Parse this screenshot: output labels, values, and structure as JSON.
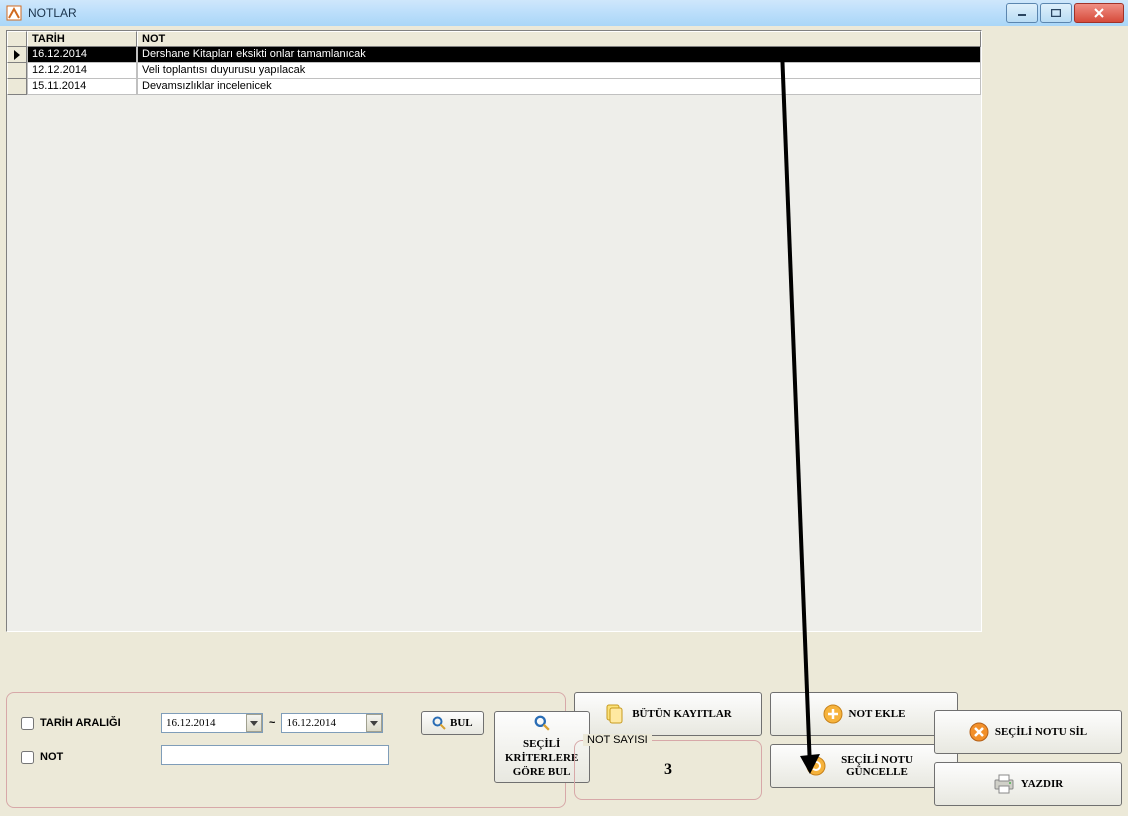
{
  "window": {
    "title": "NOTLAR"
  },
  "grid": {
    "columns": {
      "tarih": "TARİH",
      "not": "NOT"
    },
    "rows": [
      {
        "tarih": "16.12.2014",
        "not": "Dershane Kitapları eksikti onlar tamamlanıcak",
        "selected": true
      },
      {
        "tarih": "12.12.2014",
        "not": "Veli toplantısı duyurusu yapılacak",
        "selected": false
      },
      {
        "tarih": "15.11.2014",
        "not": "Devamsızlıklar incelenicek",
        "selected": false
      }
    ]
  },
  "filter": {
    "tarih_label": "TARİH ARALIĞI",
    "not_label": "NOT",
    "date_from": "16.12.2014",
    "date_to": "16.12.2014",
    "note_value": "",
    "bul_label": "BUL",
    "kriter_label": "SEÇİLİ KRİTERLERE GÖRE BUL"
  },
  "buttons": {
    "all_records": "BÜTÜN KAYITLAR",
    "add_note": "NOT EKLE",
    "delete_selected": "SEÇİLİ NOTU  SİL",
    "update_selected": "SEÇİLİ NOTU GÜNCELLE",
    "print": "YAZDIR"
  },
  "count": {
    "label": "NOT SAYISI",
    "value": "3"
  }
}
